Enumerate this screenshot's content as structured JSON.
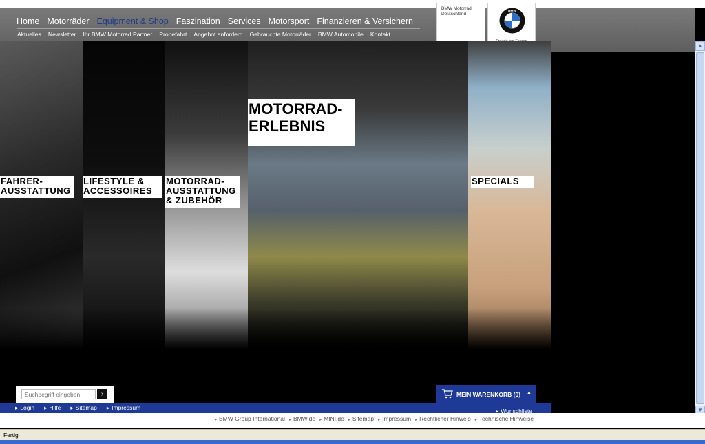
{
  "header": {
    "main_nav": [
      "Home",
      "Motorräder",
      "Equipment & Shop",
      "Faszination",
      "Services",
      "Motorsport",
      "Finanzieren & Versichern"
    ],
    "active_main_nav": "Equipment & Shop",
    "sub_nav": [
      "Aktuelles",
      "Newsletter",
      "Ihr BMW Motorrad Partner",
      "Probefahrt",
      "Angebot anfordern",
      "Gebrauchte Motorräder",
      "BMW Automobile",
      "Kontakt"
    ],
    "brand_line1": "BMW Motorrad",
    "brand_line2": "Deutschland",
    "claim": "Freude am Fahren",
    "roundel_letters": "BMW"
  },
  "panels": [
    {
      "label": "FAHRER-\nAUSSTATTUNG"
    },
    {
      "label": "LIFESTYLE &\nACCESSOIRES"
    },
    {
      "label": "MOTORRAD-\nAUSSTATTUNG\n& ZUBEHÖR"
    },
    {
      "label": "MOTORRAD-\nERLEBNIS"
    },
    {
      "label": "SPECIALS"
    }
  ],
  "search": {
    "placeholder": "Suchbegriff eingeben",
    "go": "›"
  },
  "cart": {
    "label": "MEIN WARENKORB (0)",
    "arrow": "▲"
  },
  "bottom_links": [
    "Login",
    "Hilfe",
    "Sitemap",
    "Impressum"
  ],
  "wishlist": "Wunschliste",
  "footer_links": [
    "BMW Group International",
    "BMW.de",
    "MINI.de",
    "Sitemap",
    "Impressum",
    "Rechtlicher Hinweis",
    "Technische Hinweise"
  ],
  "status": "Fertig",
  "colors": {
    "accent": "#1e3a96",
    "active_nav": "#1e3a8a"
  }
}
